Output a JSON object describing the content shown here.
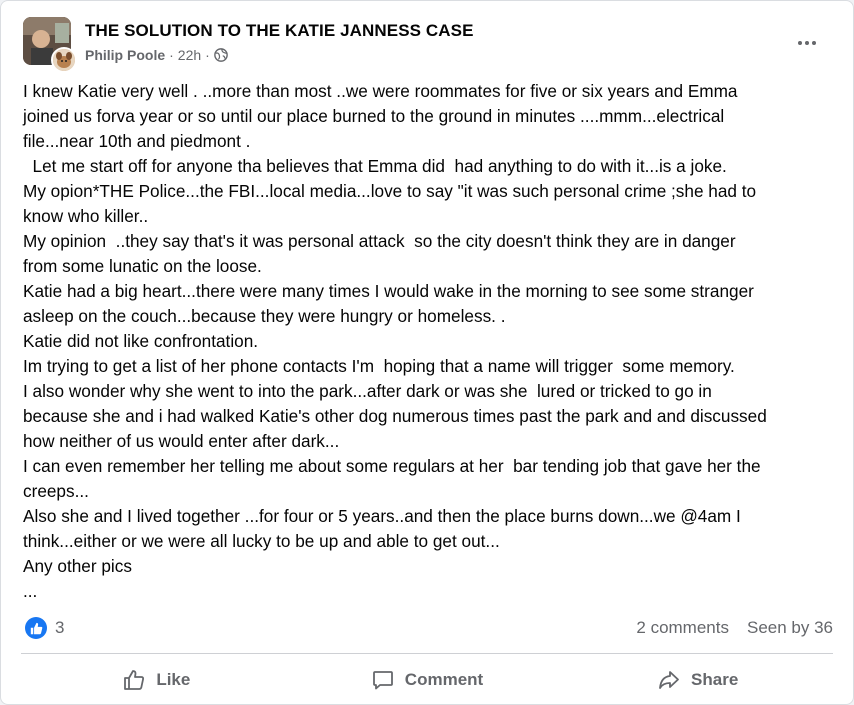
{
  "post": {
    "group_title": "THE SOLUTION TO THE KATIE JANNESS CASE",
    "author": "Philip Poole",
    "time": "22h",
    "separator": "·",
    "body_lines": [
      "I knew Katie very well . ..more than most ..we were roommates for five or six years and Emma",
      "joined us forva year or so until our place burned to the ground in minutes ....mmm...electrical",
      "file...near 10th and piedmont .",
      "  Let me start off for anyone tha believes that Emma did  had anything to do with it...is a joke.",
      "My opion*THE Police...the FBI...local media...love to say \"it was such personal crime ;she had to",
      "know who killer..",
      "My opinion  ..they say that's it was personal attack  so the city doesn't think they are in danger",
      "from some lunatic on the loose.",
      "Katie had a big heart...there were many times I would wake in the morning to see some stranger",
      "asleep on the couch...because they were hungry or homeless. .",
      "Katie did not like confrontation.",
      "Im trying to get a list of her phone contacts I'm  hoping that a name will trigger  some memory.",
      "I also wonder why she went to into the park...after dark or was she  lured or tricked to go in",
      "because she and i had walked Katie's other dog numerous times past the park and and discussed",
      "how neither of us would enter after dark...",
      "I can even remember her telling me about some regulars at her  bar tending job that gave her the",
      "creeps...",
      "Also she and I lived together ...for four or 5 years..and then the place burns down...we @4am I",
      "think...either or we were all lucky to be up and able to get out...",
      "Any other pics",
      "..."
    ]
  },
  "reactions": {
    "count": "3",
    "icon": "like-icon"
  },
  "stats": {
    "comments": "2 comments",
    "seen_by": "Seen by 36"
  },
  "actions": {
    "like": "Like",
    "comment": "Comment",
    "share": "Share"
  },
  "colors": {
    "accent": "#1877f2",
    "secondary_text": "#65676b",
    "divider": "#ced0d4"
  }
}
